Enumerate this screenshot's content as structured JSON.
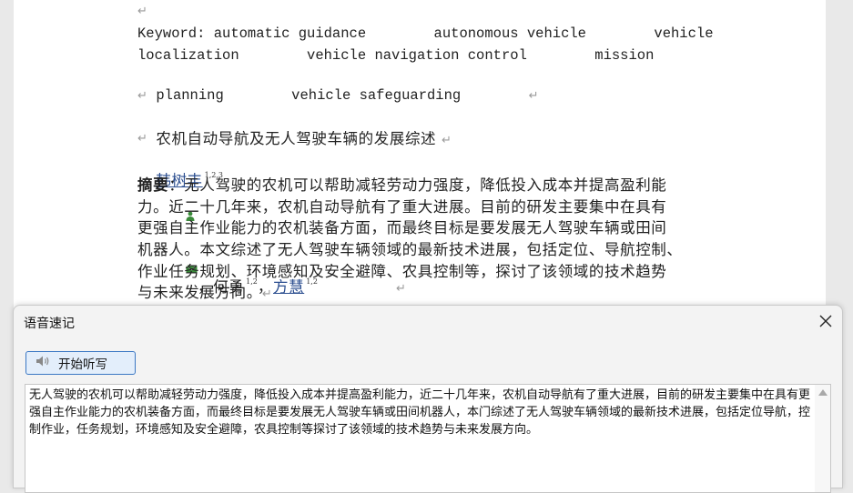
{
  "document": {
    "para_mark": "↵",
    "keyword_line1": "Keyword: automatic guidance        autonomous vehicle        vehicle",
    "keyword_line2": "localization        vehicle navigation control        mission",
    "keyword_line3": "planning        vehicle safeguarding        ",
    "title_cn": "农机自动导航及无人驾驶车辆的发展综述 ",
    "authors": [
      {
        "name": "韩树丰",
        "sup": "1,2,3"
      },
      {
        "name": "何勇",
        "sup": "1,2"
      },
      {
        "name": "方慧",
        "sup": "1,2"
      }
    ],
    "author_sep": "，",
    "abstract_label": "摘要",
    "abstract_lines": [
      "：无人驾驶的农机可以帮助减轻劳动力强度，降低投入成本并提高盈利能",
      "力。近二十几年来，农机自动导航有了重大进展。目前的研发主要集中在具有",
      "更强自主作业能力的农机装备方面，而最终目标是要发展无人驾驶车辆或田间",
      "机器人。本文综述了无人驾驶车辆领域的最新技术进展，包括定位、导航控制、",
      "作业任务规划、环境感知及安全避障、农具控制等，探讨了该领域的技术趋势",
      "与未来发展方向。"
    ]
  },
  "dialog": {
    "title": "语音速记",
    "start_button": "开始听写",
    "transcript": "无人驾驶的农机可以帮助减轻劳动力强度，降低投入成本并提高盈利能力，近二十几年来，农机自动导航有了重大进展，目前的研发主要集中在具有更强自主作业能力的农机装备方面，而最终目标是要发展无人驾驶车辆或田间机器人，本门综述了无人驾驶车辆领域的最新技术进展，包括定位导航，控制作业，任务规划，环境感知及安全避障，农具控制等探讨了该领域的技术趋势与未来发展方向。"
  }
}
